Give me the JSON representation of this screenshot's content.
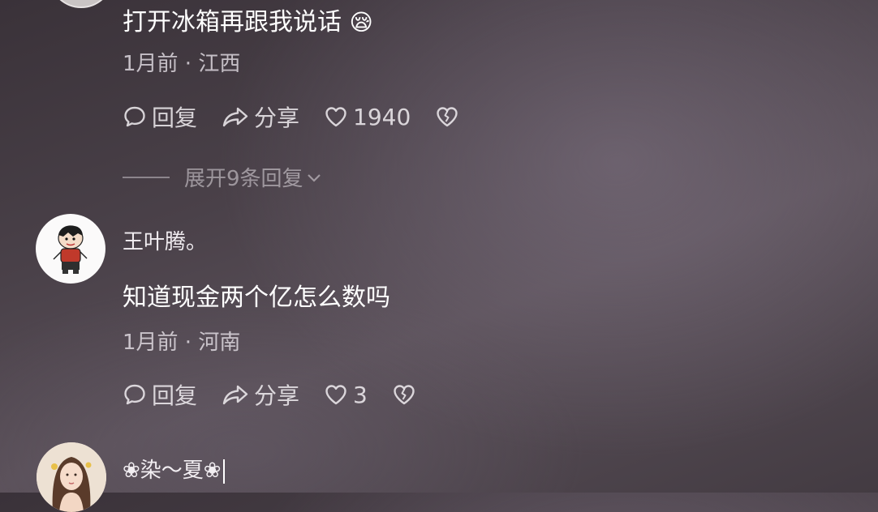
{
  "comments": [
    {
      "text": "打开冰箱再跟我说话",
      "emoji": "😪",
      "meta": "1月前 · 江西",
      "actions": {
        "reply": "回复",
        "share": "分享",
        "likes": "1940"
      },
      "expand": "展开9条回复"
    },
    {
      "username": "王叶腾。",
      "text": "知道现金两个亿怎么数吗",
      "meta": "1月前 · 河南",
      "actions": {
        "reply": "回复",
        "share": "分享",
        "likes": "3"
      }
    },
    {
      "username": "❀染～夏❀"
    }
  ]
}
